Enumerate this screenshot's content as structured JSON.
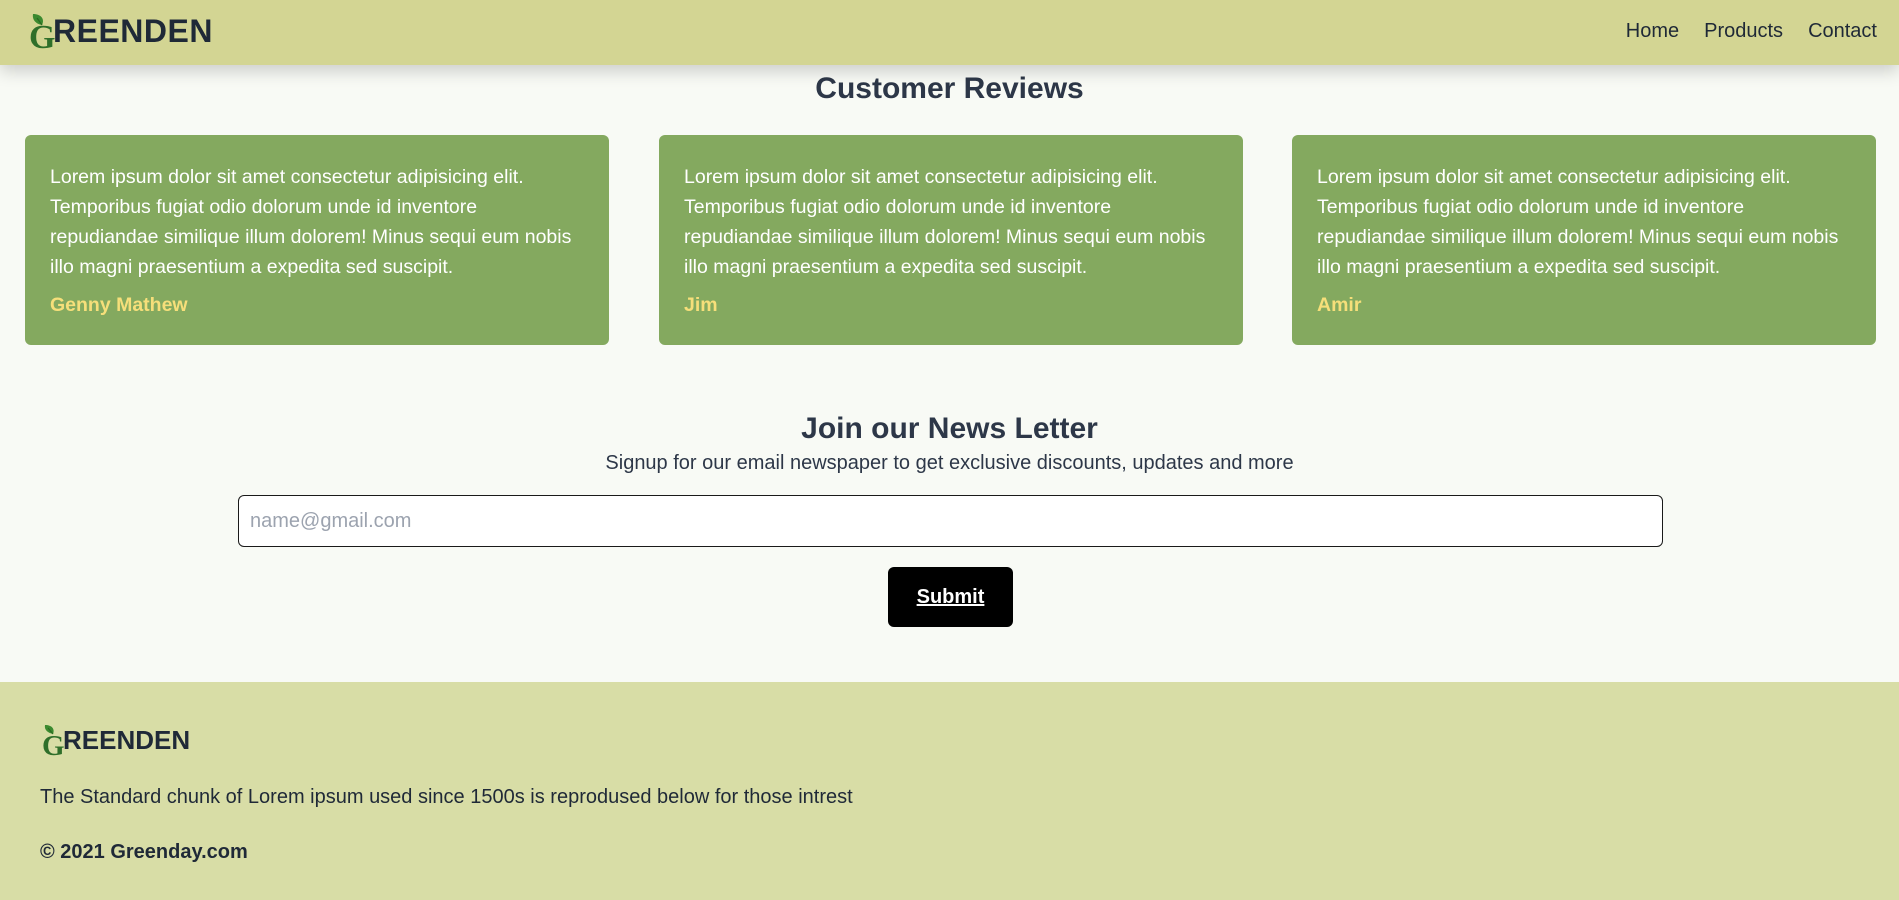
{
  "header": {
    "logo_text": "REENDEN",
    "logo_initial": "G",
    "nav": [
      "Home",
      "Products",
      "Contact"
    ]
  },
  "reviews": {
    "title": "Customer Reviews",
    "items": [
      {
        "text": "Lorem ipsum dolor sit amet consectetur adipisicing elit. Temporibus fugiat odio dolorum unde id inventore repudiandae similique illum dolorem! Minus sequi eum nobis illo magni praesentium a expedita sed suscipit.",
        "author": "Genny Mathew"
      },
      {
        "text": "Lorem ipsum dolor sit amet consectetur adipisicing elit. Temporibus fugiat odio dolorum unde id inventore repudiandae similique illum dolorem! Minus sequi eum nobis illo magni praesentium a expedita sed suscipit.",
        "author": "Jim"
      },
      {
        "text": "Lorem ipsum dolor sit amet consectetur adipisicing elit. Temporibus fugiat odio dolorum unde id inventore repudiandae similique illum dolorem! Minus sequi eum nobis illo magni praesentium a expedita sed suscipit.",
        "author": "Amir"
      }
    ]
  },
  "newsletter": {
    "title": "Join our News Letter",
    "subtitle": "Signup for our email newspaper to get exclusive discounts, updates and more",
    "email_placeholder": "name@gmail.com",
    "email_value": "",
    "submit_label": "Submit"
  },
  "footer": {
    "logo_initial": "G",
    "logo_text": "REENDEN",
    "description": "The Standard chunk of Lorem ipsum used since 1500s is reprodused below for those intrest",
    "copyright": "© 2021 Greenday.com"
  },
  "colors": {
    "header_bg": "#d3d593",
    "card_bg": "#84a95f",
    "author": "#f6df7a",
    "footer_bg": "#d8dda6",
    "leaf": "#3b8a2f"
  },
  "icons": {
    "logo": "leaf-icon"
  }
}
